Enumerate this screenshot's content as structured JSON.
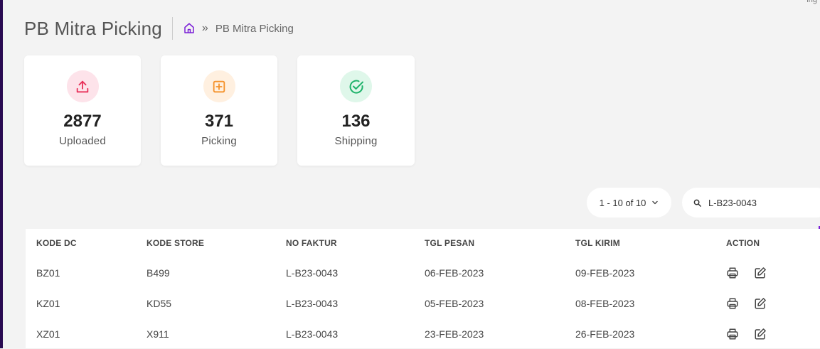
{
  "header": {
    "title": "PB Mitra Picking",
    "breadcrumb_current": "PB Mitra Picking",
    "breadcrumb_separator": "»"
  },
  "top_corner_text": "ing",
  "stats": [
    {
      "value": "2877",
      "label": "Uploaded",
      "icon": "upload-icon",
      "color": "#e8315a",
      "bg": "#fde3ea"
    },
    {
      "value": "371",
      "label": "Picking",
      "icon": "plus-square-icon",
      "color": "#f5922b",
      "bg": "#fff0e0"
    },
    {
      "value": "136",
      "label": "Shipping",
      "icon": "check-circle-icon",
      "color": "#1fb36b",
      "bg": "#dff7ea"
    }
  ],
  "pagination": {
    "label": "1 - 10 of 10"
  },
  "search": {
    "value": "L-B23-0043",
    "placeholder": ""
  },
  "table": {
    "columns": [
      "KODE DC",
      "KODE STORE",
      "NO FAKTUR",
      "TGL PESAN",
      "TGL KIRIM",
      "ACTION"
    ],
    "rows": [
      {
        "kode_dc": "BZ01",
        "kode_store": "B499",
        "no_faktur": "L-B23-0043",
        "tgl_pesan": "06-FEB-2023",
        "tgl_kirim": "09-FEB-2023"
      },
      {
        "kode_dc": "KZ01",
        "kode_store": "KD55",
        "no_faktur": "L-B23-0043",
        "tgl_pesan": "05-FEB-2023",
        "tgl_kirim": "08-FEB-2023"
      },
      {
        "kode_dc": "XZ01",
        "kode_store": "X911",
        "no_faktur": "L-B23-0043",
        "tgl_pesan": "23-FEB-2023",
        "tgl_kirim": "26-FEB-2023"
      }
    ]
  },
  "colors": {
    "accent": "#7a1fd6",
    "sidebar": "#2a0b52"
  }
}
